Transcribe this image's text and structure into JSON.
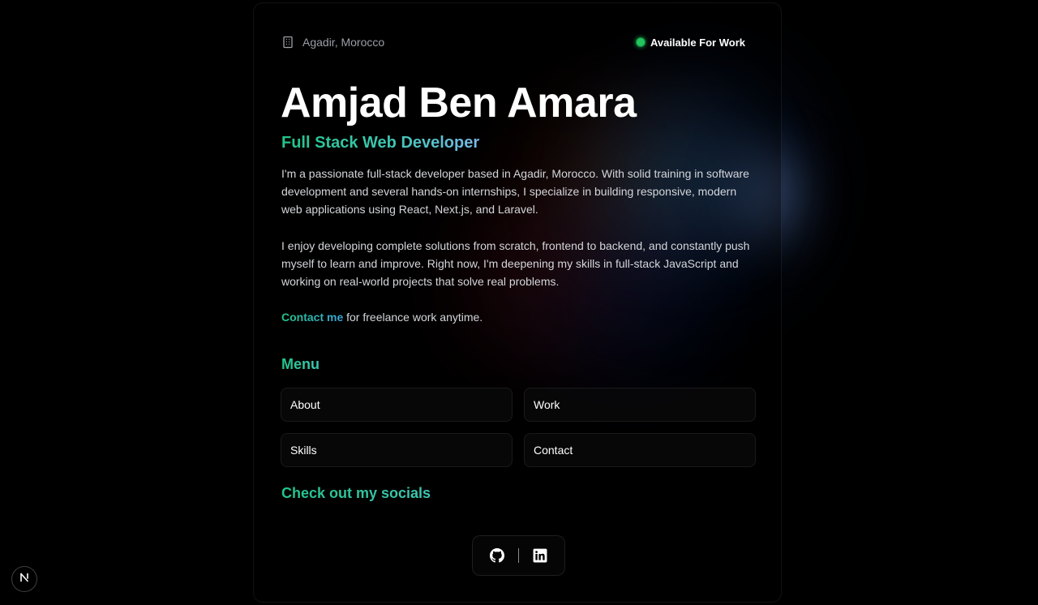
{
  "header": {
    "location": "Agadir, Morocco",
    "location_icon": "building-icon",
    "status": "Available For Work",
    "status_color": "#22c55e"
  },
  "hero": {
    "name": "Amjad Ben Amara",
    "role": "Full Stack Web Developer"
  },
  "about": {
    "paragraph_1": "I'm a passionate full-stack developer based in Agadir, Morocco. With solid training in software development and several hands-on internships, I specialize in building responsive, modern web applications using React, Next.js, and Laravel.",
    "paragraph_2": "I enjoy developing complete solutions from scratch, frontend to backend, and constantly push myself to learn and improve. Right now, I'm deepening my skills in full-stack JavaScript and working on real-world projects that solve real problems.",
    "contact_link": "Contact me",
    "contact_suffix": " for freelance work anytime."
  },
  "menu": {
    "title": "Menu",
    "items": [
      {
        "label": "About"
      },
      {
        "label": "Work"
      },
      {
        "label": "Skills"
      },
      {
        "label": "Contact"
      }
    ]
  },
  "socials": {
    "title": "Check out my socials",
    "icons": [
      "github-icon",
      "linkedin-icon"
    ]
  },
  "badge": {
    "letter": "N",
    "icon": "nextjs-icon"
  },
  "colors": {
    "accent_green": "#22c58b",
    "accent_blue": "#3aa6d8",
    "background": "#000000"
  }
}
